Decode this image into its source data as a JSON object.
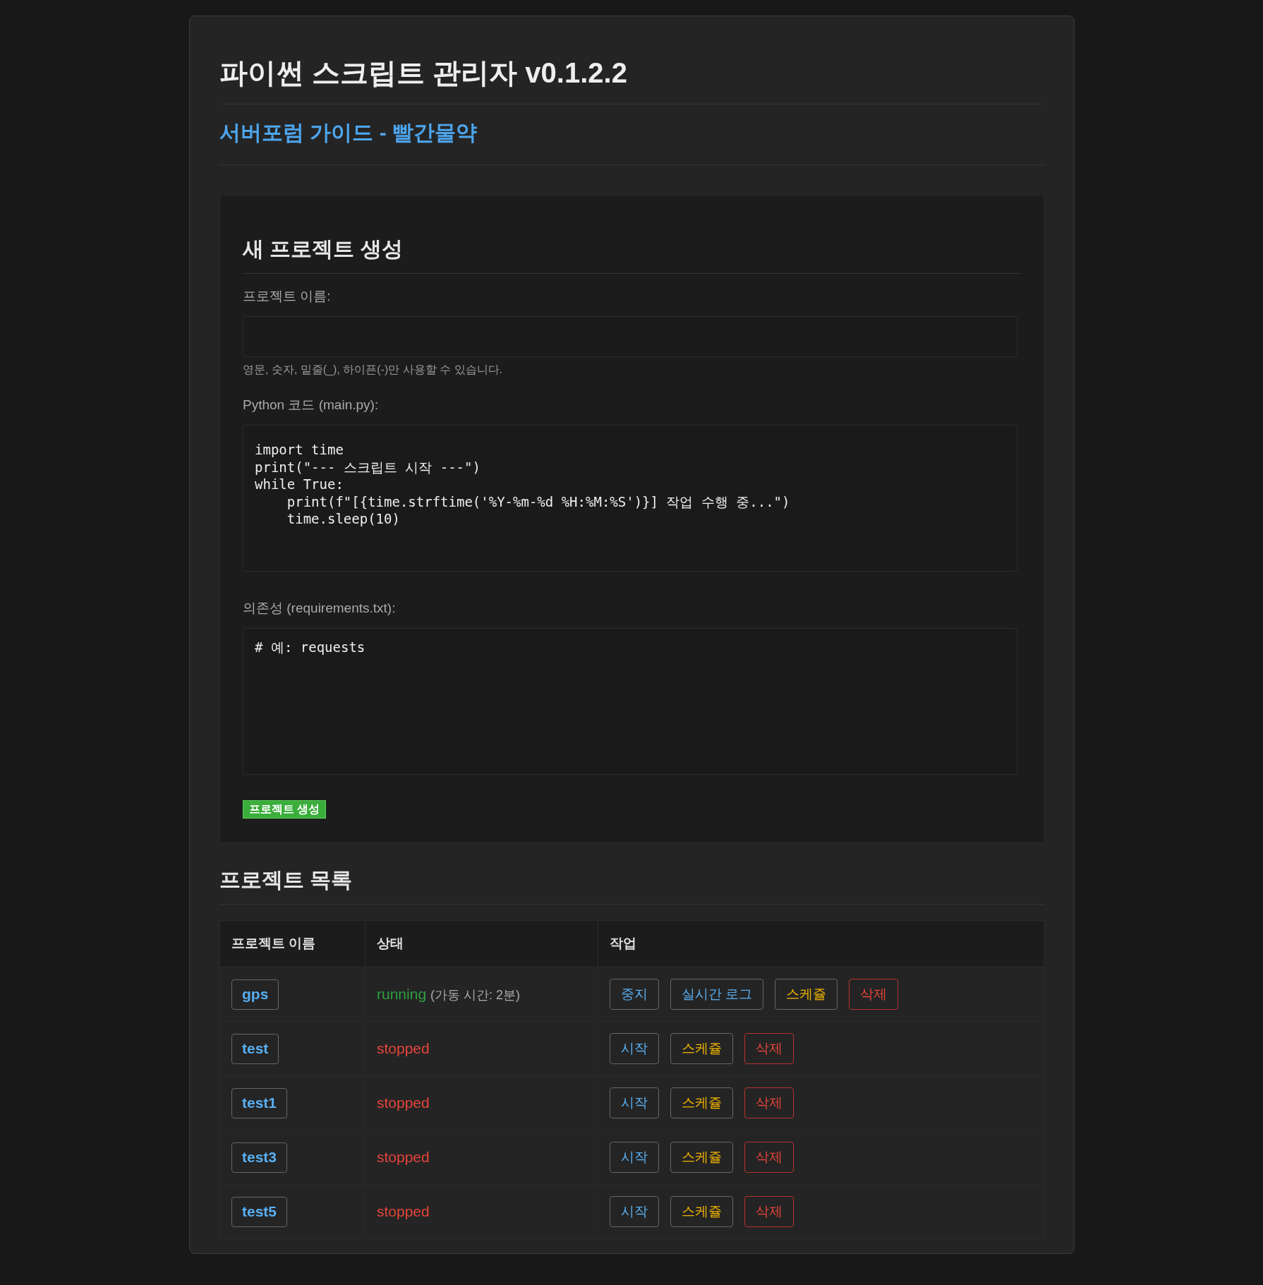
{
  "title": "파이썬 스크립트 관리자 v0.1.2.2",
  "guide_link": "서버포럼 가이드 - 빨간물약",
  "create_form": {
    "heading": "새 프로젝트 생성",
    "name_label": "프로젝트 이름:",
    "name_hint": "영문, 숫자, 밑줄(_), 하이픈(-)만 사용할 수 있습니다.",
    "code_label": "Python 코드 (main.py):",
    "code_value": "import time\nprint(\"--- 스크립트 시작 ---\")\nwhile True:\n    print(f\"[{time.strftime('%Y-%m-%d %H:%M:%S')}] 작업 수행 중...\")\n    time.sleep(10)",
    "requirements_label": "의존성 (requirements.txt):",
    "requirements_value": "# 예: requests",
    "submit": "프로젝트 생성"
  },
  "projects": {
    "heading": "프로젝트 목록",
    "columns": [
      "프로젝트 이름",
      "상태",
      "작업"
    ],
    "rows": [
      {
        "name": "gps",
        "status": "running",
        "running": true,
        "uptime": "(가동 시간: 2분)",
        "actions": [
          {
            "label": "중지",
            "kind": "primary"
          },
          {
            "label": "실시간 로그",
            "kind": "primary"
          },
          {
            "label": "스케쥴",
            "kind": "warning"
          },
          {
            "label": "삭제",
            "kind": "danger"
          }
        ]
      },
      {
        "name": "test",
        "status": "stopped",
        "running": false,
        "actions": [
          {
            "label": "시작",
            "kind": "primary"
          },
          {
            "label": "스케쥴",
            "kind": "warning"
          },
          {
            "label": "삭제",
            "kind": "danger"
          }
        ]
      },
      {
        "name": "test1",
        "status": "stopped",
        "running": false,
        "actions": [
          {
            "label": "시작",
            "kind": "primary"
          },
          {
            "label": "스케쥴",
            "kind": "warning"
          },
          {
            "label": "삭제",
            "kind": "danger"
          }
        ]
      },
      {
        "name": "test3",
        "status": "stopped",
        "running": false,
        "actions": [
          {
            "label": "시작",
            "kind": "primary"
          },
          {
            "label": "스케쥴",
            "kind": "warning"
          },
          {
            "label": "삭제",
            "kind": "danger"
          }
        ]
      },
      {
        "name": "test5",
        "status": "stopped",
        "running": false,
        "actions": [
          {
            "label": "시작",
            "kind": "primary"
          },
          {
            "label": "스케쥴",
            "kind": "warning"
          },
          {
            "label": "삭제",
            "kind": "danger"
          }
        ]
      }
    ]
  }
}
